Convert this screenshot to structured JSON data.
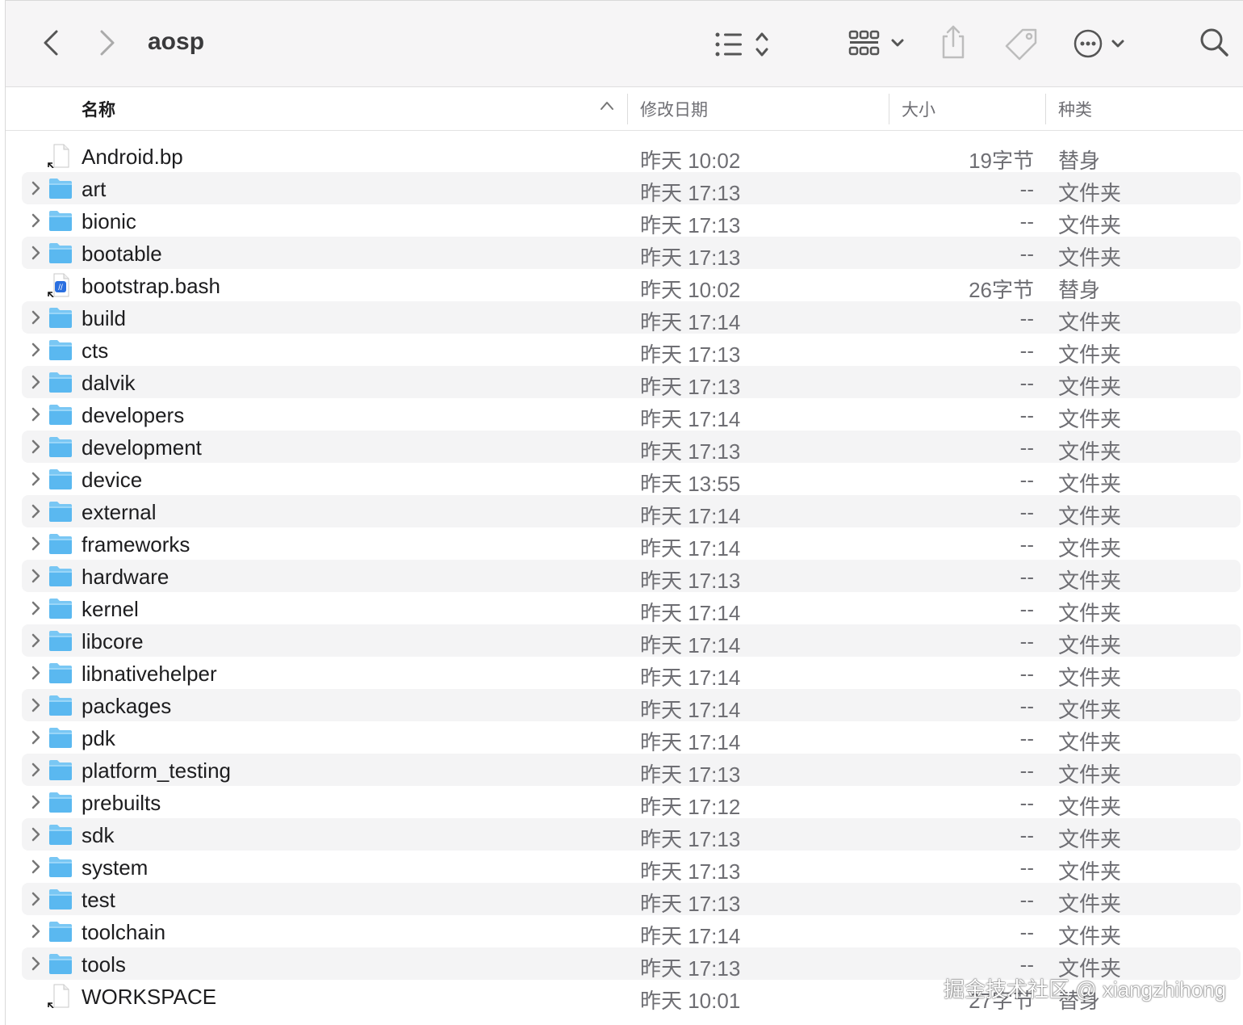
{
  "toolbar": {
    "title": "aosp",
    "back_icon": "chevron-left-icon",
    "forward_icon": "chevron-right-icon",
    "view_icon": "list-view-icon",
    "group_icon": "grid-group-icon",
    "share_icon": "share-icon",
    "tag_icon": "tag-icon",
    "more_icon": "ellipsis-circle-icon",
    "search_icon": "search-icon"
  },
  "columns": {
    "name": "名称",
    "date": "修改日期",
    "size": "大小",
    "kind": "种类"
  },
  "files": [
    {
      "name": "Android.bp",
      "date": "昨天 10:02",
      "size": "19字节",
      "kind": "替身",
      "type": "alias"
    },
    {
      "name": "art",
      "date": "昨天 17:13",
      "size": "--",
      "kind": "文件夹",
      "type": "folder"
    },
    {
      "name": "bionic",
      "date": "昨天 17:13",
      "size": "--",
      "kind": "文件夹",
      "type": "folder"
    },
    {
      "name": "bootable",
      "date": "昨天 17:13",
      "size": "--",
      "kind": "文件夹",
      "type": "folder"
    },
    {
      "name": "bootstrap.bash",
      "date": "昨天 10:02",
      "size": "26字节",
      "kind": "替身",
      "type": "alias-script"
    },
    {
      "name": "build",
      "date": "昨天 17:14",
      "size": "--",
      "kind": "文件夹",
      "type": "folder"
    },
    {
      "name": "cts",
      "date": "昨天 17:13",
      "size": "--",
      "kind": "文件夹",
      "type": "folder"
    },
    {
      "name": "dalvik",
      "date": "昨天 17:13",
      "size": "--",
      "kind": "文件夹",
      "type": "folder"
    },
    {
      "name": "developers",
      "date": "昨天 17:14",
      "size": "--",
      "kind": "文件夹",
      "type": "folder"
    },
    {
      "name": "development",
      "date": "昨天 17:13",
      "size": "--",
      "kind": "文件夹",
      "type": "folder"
    },
    {
      "name": "device",
      "date": "昨天 13:55",
      "size": "--",
      "kind": "文件夹",
      "type": "folder"
    },
    {
      "name": "external",
      "date": "昨天 17:14",
      "size": "--",
      "kind": "文件夹",
      "type": "folder"
    },
    {
      "name": "frameworks",
      "date": "昨天 17:14",
      "size": "--",
      "kind": "文件夹",
      "type": "folder"
    },
    {
      "name": "hardware",
      "date": "昨天 17:13",
      "size": "--",
      "kind": "文件夹",
      "type": "folder"
    },
    {
      "name": "kernel",
      "date": "昨天 17:14",
      "size": "--",
      "kind": "文件夹",
      "type": "folder"
    },
    {
      "name": "libcore",
      "date": "昨天 17:14",
      "size": "--",
      "kind": "文件夹",
      "type": "folder"
    },
    {
      "name": "libnativehelper",
      "date": "昨天 17:14",
      "size": "--",
      "kind": "文件夹",
      "type": "folder"
    },
    {
      "name": "packages",
      "date": "昨天 17:14",
      "size": "--",
      "kind": "文件夹",
      "type": "folder"
    },
    {
      "name": "pdk",
      "date": "昨天 17:14",
      "size": "--",
      "kind": "文件夹",
      "type": "folder"
    },
    {
      "name": "platform_testing",
      "date": "昨天 17:13",
      "size": "--",
      "kind": "文件夹",
      "type": "folder"
    },
    {
      "name": "prebuilts",
      "date": "昨天 17:12",
      "size": "--",
      "kind": "文件夹",
      "type": "folder"
    },
    {
      "name": "sdk",
      "date": "昨天 17:13",
      "size": "--",
      "kind": "文件夹",
      "type": "folder"
    },
    {
      "name": "system",
      "date": "昨天 17:13",
      "size": "--",
      "kind": "文件夹",
      "type": "folder"
    },
    {
      "name": "test",
      "date": "昨天 17:13",
      "size": "--",
      "kind": "文件夹",
      "type": "folder"
    },
    {
      "name": "toolchain",
      "date": "昨天 17:14",
      "size": "--",
      "kind": "文件夹",
      "type": "folder"
    },
    {
      "name": "tools",
      "date": "昨天 17:13",
      "size": "--",
      "kind": "文件夹",
      "type": "folder"
    },
    {
      "name": "WORKSPACE",
      "date": "昨天 10:01",
      "size": "27字节",
      "kind": "替身",
      "type": "alias"
    }
  ],
  "watermark": "掘金技术社区 @ xiangzhihong",
  "colors": {
    "folder": "#5ab8f0",
    "folder_tab": "#79c7f4",
    "row_alt": "#f4f4f5",
    "secondary_text": "#6e6e73"
  }
}
